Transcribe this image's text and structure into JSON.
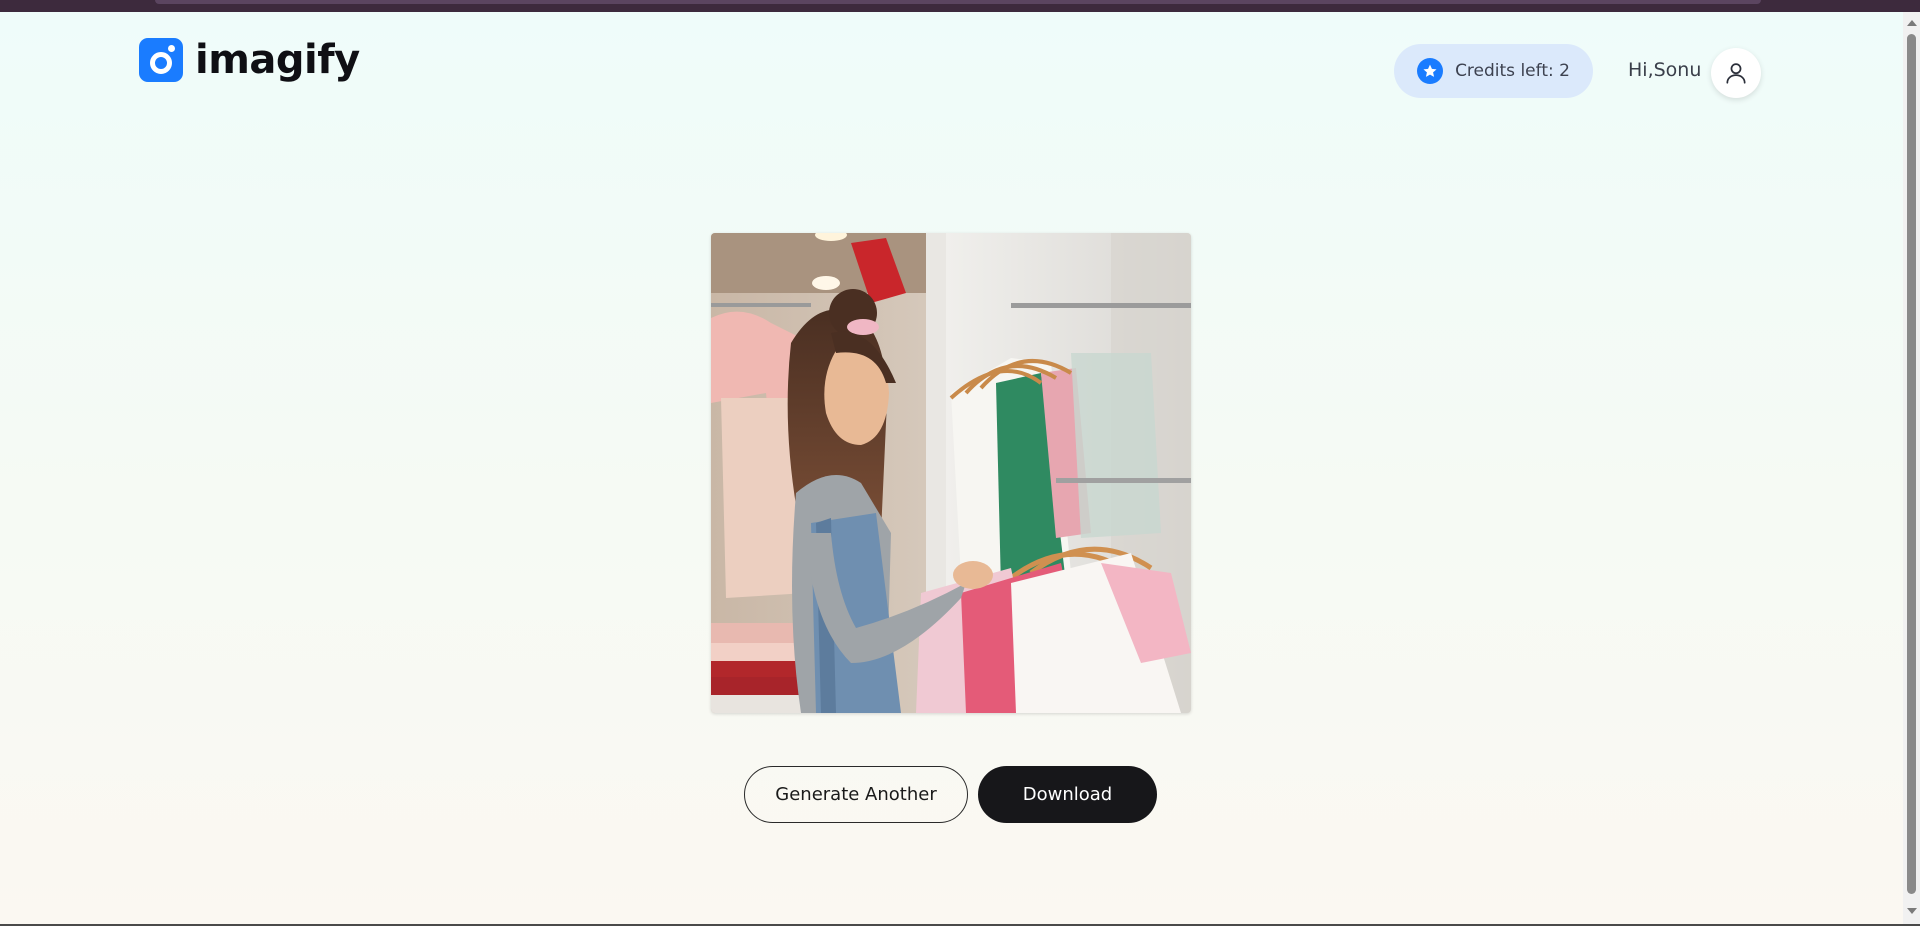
{
  "header": {
    "brand": "imagify",
    "credits_label": "Credits left: 2",
    "greeting": "Hi,Sonu",
    "icons": {
      "credits": "star-icon",
      "profile": "user-icon"
    },
    "accent_color": "#1a7cff",
    "credits_bg_color": "#dbe9fb"
  },
  "result": {
    "image_icon": "generated-image"
  },
  "actions": {
    "generate_another_label": "Generate Another",
    "download_label": "Download",
    "download_bg_color": "#17171a"
  }
}
